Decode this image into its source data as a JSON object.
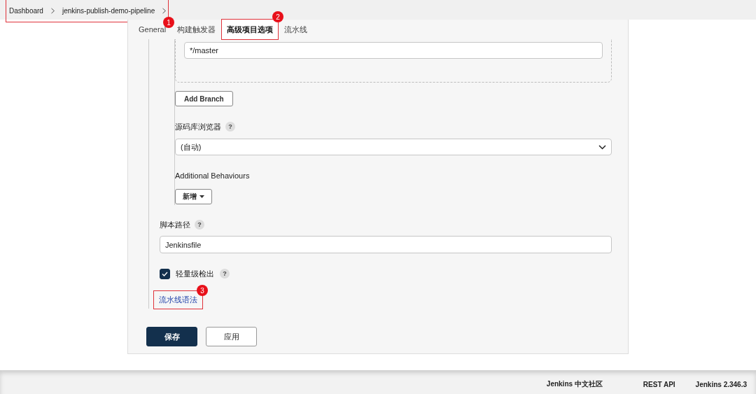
{
  "breadcrumb": {
    "items": [
      "Dashboard",
      "jenkins-publish-demo-pipeline"
    ],
    "annotation": "1"
  },
  "tabs": [
    {
      "label": "General",
      "selected": false
    },
    {
      "label": "构建触发器",
      "selected": false
    },
    {
      "label": "高级项目选项",
      "selected": true,
      "annotation": "2"
    },
    {
      "label": "流水线",
      "selected": false
    }
  ],
  "branch_specifier": {
    "value": "*/master"
  },
  "add_branch_button": "Add Branch",
  "repository_browser": {
    "label": "源码库浏览器",
    "help": "?",
    "value": "(自动)"
  },
  "additional_behaviours": {
    "label": "Additional Behaviours",
    "button": "新增"
  },
  "script_path": {
    "label": "脚本路径",
    "help": "?",
    "value": "Jenkinsfile"
  },
  "lightweight_checkout": {
    "label": "轻量级检出",
    "help": "?",
    "checked": true
  },
  "pipeline_syntax_link": {
    "label": "流水线语法",
    "annotation": "3"
  },
  "buttons": [
    {
      "label": "保存",
      "kind": "primary"
    },
    {
      "label": "应用",
      "kind": "secondary"
    }
  ],
  "footer": [
    "Jenkins 中文社区",
    "REST API",
    "Jenkins 2.346.3"
  ]
}
